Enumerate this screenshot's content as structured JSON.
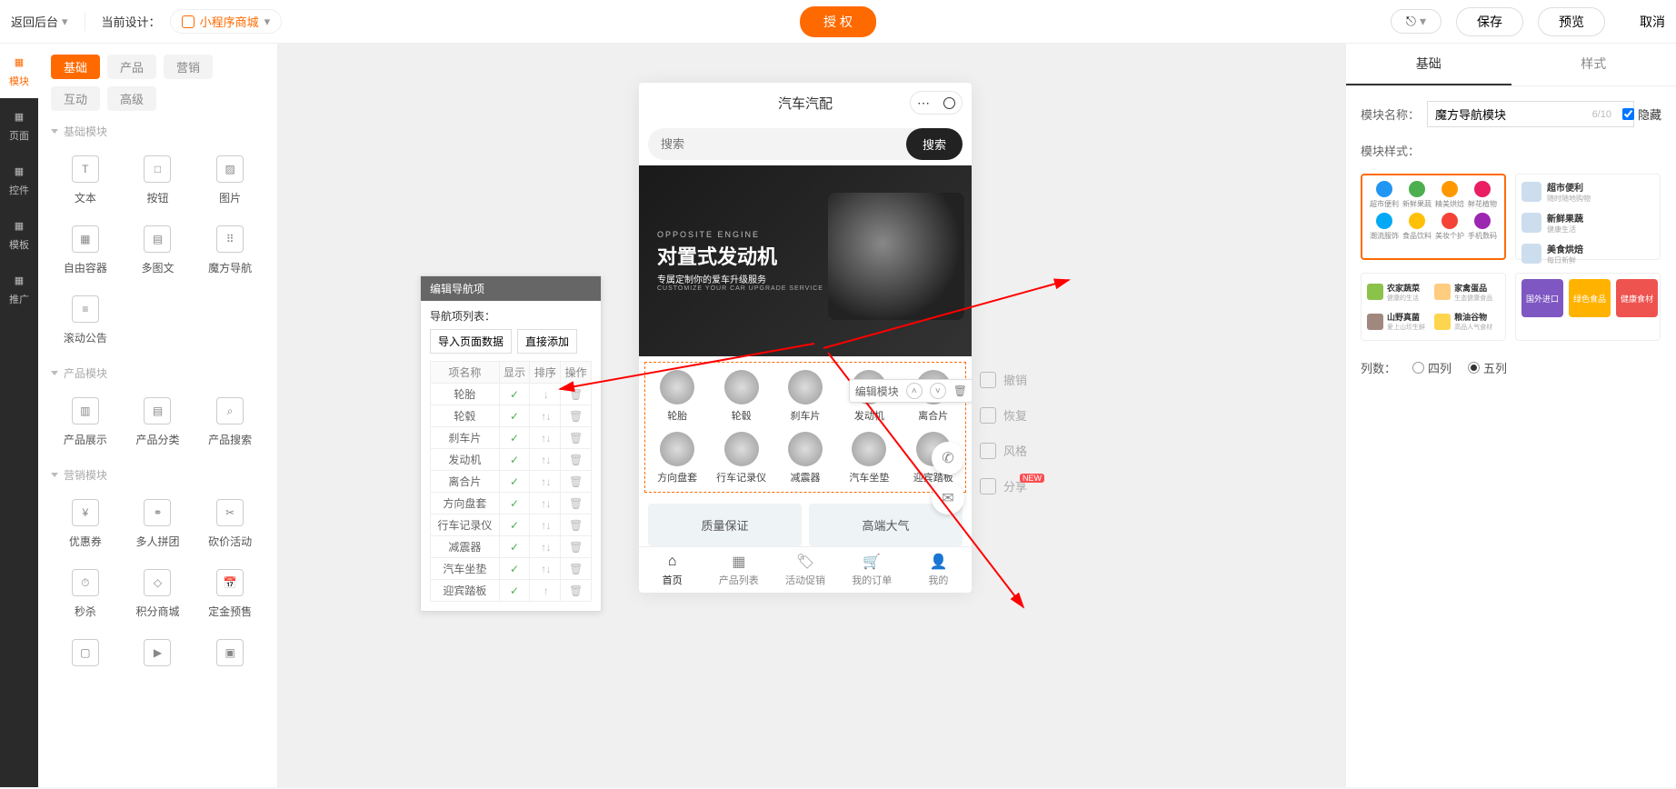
{
  "topbar": {
    "back": "返回后台",
    "current_design_label": "当前设计：",
    "design_name": "小程序商城",
    "auth_btn": "授 权",
    "save": "保存",
    "preview": "预览",
    "cancel": "取消"
  },
  "left_rail": [
    {
      "label": "模块",
      "icon": "grid",
      "active": true
    },
    {
      "label": "页面",
      "icon": "page"
    },
    {
      "label": "控件",
      "icon": "ctrl"
    },
    {
      "label": "模板",
      "icon": "tmpl"
    },
    {
      "label": "推广",
      "icon": "horn"
    }
  ],
  "left_panel": {
    "tabs": [
      "基础",
      "产品",
      "营销",
      "互动",
      "高级"
    ],
    "active_tab": "基础",
    "groups": [
      {
        "title": "基础模块",
        "items": [
          {
            "label": "文本",
            "icon": "T"
          },
          {
            "label": "按钮",
            "icon": "□"
          },
          {
            "label": "图片",
            "icon": "▨"
          },
          {
            "label": "自由容器",
            "icon": "▦"
          },
          {
            "label": "多图文",
            "icon": "▤"
          },
          {
            "label": "魔方导航",
            "icon": "⠿"
          },
          {
            "label": "滚动公告",
            "icon": "≡"
          }
        ]
      },
      {
        "title": "产品模块",
        "items": [
          {
            "label": "产品展示",
            "icon": "▥"
          },
          {
            "label": "产品分类",
            "icon": "▤"
          },
          {
            "label": "产品搜索",
            "icon": "⌕"
          }
        ]
      },
      {
        "title": "营销模块",
        "items": [
          {
            "label": "优惠券",
            "icon": "¥"
          },
          {
            "label": "多人拼团",
            "icon": "⚭"
          },
          {
            "label": "砍价活动",
            "icon": "✂"
          },
          {
            "label": "秒杀",
            "icon": "⏱"
          },
          {
            "label": "积分商城",
            "icon": "◇"
          },
          {
            "label": "定金预售",
            "icon": "📅"
          },
          {
            "label": "",
            "icon": "▢"
          },
          {
            "label": "",
            "icon": "▶"
          },
          {
            "label": "",
            "icon": "▣"
          }
        ]
      }
    ]
  },
  "nav_editor": {
    "title": "编辑导航项",
    "list_label": "导航项列表：",
    "import_btn": "导入页面数据",
    "add_btn": "直接添加",
    "headers": [
      "项名称",
      "显示",
      "排序",
      "操作"
    ],
    "rows": [
      {
        "name": "轮胎"
      },
      {
        "name": "轮毂"
      },
      {
        "name": "刹车片"
      },
      {
        "name": "发动机"
      },
      {
        "name": "离合片"
      },
      {
        "name": "方向盘套"
      },
      {
        "name": "行车记录仪"
      },
      {
        "name": "减震器"
      },
      {
        "name": "汽车坐垫"
      },
      {
        "name": "迎宾踏板"
      }
    ]
  },
  "phone": {
    "title": "汽车汽配",
    "search_placeholder": "搜索",
    "search_btn": "搜索",
    "banner": {
      "top": "OPPOSITE ENGINE",
      "main": "对置式发动机",
      "sub": "专属定制你的爱车升级服务",
      "en": "CUSTOMIZE YOUR CAR UPGRADE SERVICE"
    },
    "module_toolbar_label": "编辑模块",
    "nav_items": [
      "轮胎",
      "轮毂",
      "刹车片",
      "发动机",
      "离合片",
      "方向盘套",
      "行车记录仪",
      "减震器",
      "汽车坐垫",
      "迎宾踏板"
    ],
    "quality_cards": [
      "质量保证",
      "高端大气"
    ],
    "tabbar": [
      "首页",
      "产品列表",
      "活动促销",
      "我的订单",
      "我的"
    ]
  },
  "side_actions": [
    {
      "label": "撤销",
      "icon": "undo"
    },
    {
      "label": "恢复",
      "icon": "redo"
    },
    {
      "label": "风格",
      "icon": "shirt"
    },
    {
      "label": "分享",
      "icon": "share",
      "new": "NEW"
    }
  ],
  "right_panel": {
    "tabs": [
      "基础",
      "样式"
    ],
    "active": "基础",
    "module_name_label": "模块名称：",
    "module_name_value": "魔方导航模块",
    "module_name_count": "6/10",
    "hide_checkbox": "隐藏",
    "style_label": "模块样式：",
    "style1_row1": [
      {
        "t": "超市便利",
        "c": "#2196f3"
      },
      {
        "t": "新鲜果蔬",
        "c": "#4caf50"
      },
      {
        "t": "精美烘焙",
        "c": "#ff9800"
      },
      {
        "t": "鲜花植物",
        "c": "#e91e63"
      }
    ],
    "style1_row2": [
      {
        "t": "潮流服饰",
        "c": "#03a9f4"
      },
      {
        "t": "食品饮料",
        "c": "#ffc107"
      },
      {
        "t": "美妆个护",
        "c": "#f44336"
      },
      {
        "t": "手机数码",
        "c": "#9c27b0"
      }
    ],
    "style2": [
      {
        "t1": "超市便利",
        "t2": "随时随地购物"
      },
      {
        "t1": "新鲜果蔬",
        "t2": "健康生活"
      },
      {
        "t1": "美食烘焙",
        "t2": "每日新鲜"
      }
    ],
    "style3": [
      {
        "t1": "农家蔬菜",
        "t2": "健康的生活",
        "img": "#8bc34a"
      },
      {
        "t1": "家禽蛋品",
        "t2": "生态健康食品",
        "img": "#ffcc80"
      },
      {
        "t1": "山野真菌",
        "t2": "爱上山珍生鲜",
        "img": "#a1887f"
      },
      {
        "t1": "粮油谷物",
        "t2": "高品人气食材",
        "img": "#ffd54f"
      }
    ],
    "style4": [
      {
        "t": "国外进口",
        "c": "#7e57c2"
      },
      {
        "t": "绿色食品",
        "c": "#ffb300"
      },
      {
        "t": "健康食材",
        "c": "#ef5350"
      }
    ],
    "cols_label": "列数：",
    "cols_options": [
      "四列",
      "五列"
    ],
    "cols_selected": "五列"
  }
}
